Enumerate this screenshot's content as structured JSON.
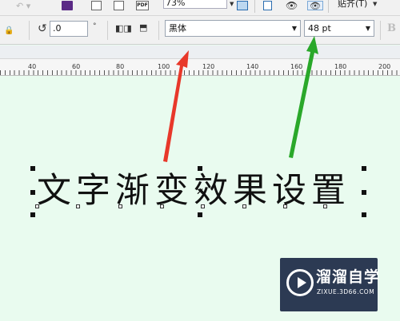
{
  "toolbar": {
    "zoom_value": "73%",
    "snap_label": "贴齐(T)",
    "pdf_label": "PDF"
  },
  "propbar": {
    "rotation_value": ".0",
    "degree_symbol": "°",
    "font_family": "黑体",
    "font_size": "48 pt",
    "bold_label": "B"
  },
  "ruler": {
    "labels": [
      "40",
      "60",
      "80",
      "100",
      "120",
      "140",
      "160",
      "180",
      "200"
    ]
  },
  "canvas": {
    "headline": "文字渐变效果设置"
  },
  "annotations": {
    "red_arrow_color": "#e8382a",
    "green_arrow_color": "#2aa82a"
  },
  "watermark": {
    "title": "溜溜自学",
    "url": "ZIXUE.3D66.COM",
    "bg_color": "#2c3a53"
  }
}
